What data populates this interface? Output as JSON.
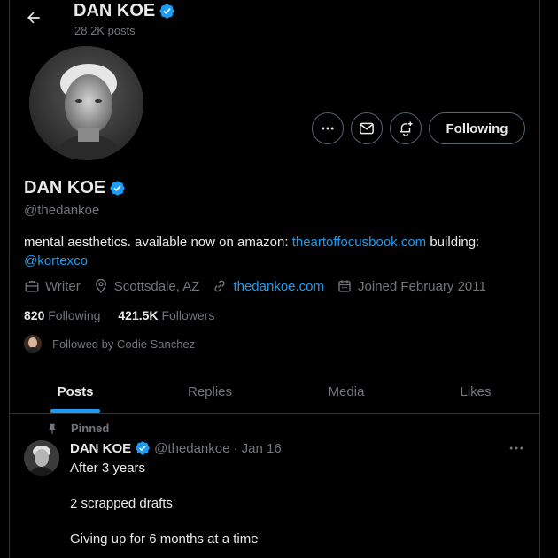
{
  "header": {
    "name": "DAN KOE",
    "posts_count": "28.2K posts"
  },
  "profile": {
    "name": "DAN KOE",
    "handle": "@thedankoe",
    "bio_text": "mental aesthetics. available now on amazon: ",
    "bio_link": "theartoffocusbook.com",
    "bio_after": " building: ",
    "bio_mention": "@kortexco",
    "occupation": "Writer",
    "location": "Scottsdale, AZ",
    "website": "thedankoe.com",
    "joined": "Joined February 2011",
    "following_count": "820",
    "following_label": "Following",
    "followers_count": "421.5K",
    "followers_label": "Followers",
    "followed_by": "Followed by Codie Sanchez"
  },
  "actions": {
    "following_label": "Following"
  },
  "tabs": [
    {
      "label": "Posts",
      "active": true
    },
    {
      "label": "Replies",
      "active": false
    },
    {
      "label": "Media",
      "active": false
    },
    {
      "label": "Likes",
      "active": false
    }
  ],
  "pinned_post": {
    "pinned_label": "Pinned",
    "author_name": "DAN KOE",
    "author_handle": "@thedankoe",
    "date": "· Jan 16",
    "lines": [
      "After 3 years",
      "2 scrapped drafts",
      "Giving up for 6 months at a time"
    ]
  },
  "colors": {
    "accent": "#1d9bf0",
    "background": "#000000",
    "muted": "#71767b",
    "border": "#2f3336"
  }
}
